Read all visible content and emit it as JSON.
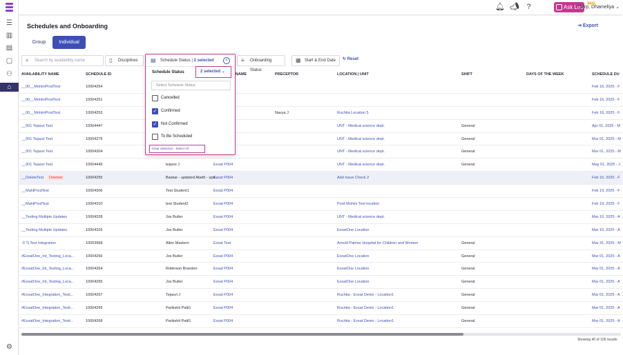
{
  "app": {
    "brand_color": "#8b3fd0",
    "accent": "#3d4fb5",
    "highlight": "#c0398f",
    "ask_leo": "Ask Leo",
    "beta": "BETA",
    "user": "Darp, Dhameliya"
  },
  "page": {
    "title": "Schedules and Onboarding",
    "export": "Export",
    "tabs": [
      "Group",
      "Individual"
    ],
    "active_tab": "Individual"
  },
  "filters": {
    "search_placeholder": "Search by availability name",
    "disciplines": "Disciplines",
    "onboarding_status": "Onboarding Status",
    "start_end_date": "Start & End Date",
    "reset": "Reset"
  },
  "dropdown": {
    "header": "Schedule Status",
    "selected_count": "2 selected",
    "label": "Schedule Status",
    "select_value": "2 selected",
    "search_placeholder": "Select Schedule Status",
    "options": [
      {
        "label": "Cancelled",
        "checked": false
      },
      {
        "label": "Confirmed",
        "checked": true
      },
      {
        "label": "Not Confirmed",
        "checked": true
      },
      {
        "label": "To Be Scheduled",
        "checked": false
      }
    ],
    "footer": "Clear Selection · Select All"
  },
  "table": {
    "headers": [
      "AVAILABILITY NAME",
      "SCHEDULE ID",
      "NAME",
      "PRECEPTOR",
      "LOCATION | UNIT",
      "SHIFT",
      "DAYS OF THE WEEK",
      "SCHEDULE DU"
    ],
    "rows": [
      {
        "name": "__00__MohiniProdTest",
        "id": "10004254",
        "student": "",
        "preceptor": "",
        "preceptor_name": "",
        "location": "",
        "shift": "",
        "date": "Feb 16, 2025 - F",
        "deleted": false
      },
      {
        "name": "__00__MohiniProdTest",
        "id": "10004251",
        "student": "",
        "preceptor": "",
        "preceptor_name": "",
        "location": "",
        "shift": "",
        "date": "Feb 16, 2025 - F",
        "deleted": false
      },
      {
        "name": "__00__MohiniProdTest",
        "id": "10004253",
        "student": "",
        "preceptor": "",
        "preceptor_name": "Navya J",
        "location": "Ruchita Location 5",
        "shift": "",
        "date": "Feb 16, 2025 - F",
        "deleted": false
      },
      {
        "name": "__001 Tejasvi Test",
        "id": "10004447",
        "student": "",
        "preceptor": "",
        "preceptor_name": "",
        "location": "UNT - Medical science dept.",
        "shift": "General",
        "date": "Apr 01, 2025 - M",
        "deleted": false
      },
      {
        "name": "__001 Tejasvi Test",
        "id": "10004275",
        "student": "",
        "preceptor": "",
        "preceptor_name": "",
        "location": "UNT - Medical science dept.",
        "shift": "General",
        "date": "Mar 01, 2025 - M",
        "deleted": false
      },
      {
        "name": "__001 Tejasvi Test",
        "id": "10004304",
        "student": "",
        "preceptor": "",
        "preceptor_name": "",
        "location": "UNT - Medical science dept.",
        "shift": "General",
        "date": "Mar 01, 2025 - M",
        "deleted": false
      },
      {
        "name": "__001 Tejasvi Test",
        "id": "10004449",
        "student": "tejasvi J",
        "preceptor": "Exxat P004",
        "preceptor_name": "",
        "location": "UNT - Medical science dept.",
        "shift": "General",
        "date": "May 01, 2025 - J",
        "deleted": false
      },
      {
        "name": "__DeleteTest",
        "id": "10004255",
        "student": "Baskar - updated Abeth - upd...",
        "preceptor": "Exxat P004",
        "preceptor_name": "",
        "location": "Add Issue Check 2",
        "shift": "",
        "date": "Feb 16, 2025 - F",
        "deleted": true
      },
      {
        "name": "__MahiProdTest",
        "id": "10004306",
        "student": "Test Student1",
        "preceptor": "Exxat P004",
        "preceptor_name": "",
        "location": "",
        "shift": "",
        "date": "Feb 19, 2025 - F",
        "deleted": false
      },
      {
        "name": "__MahiProdTest",
        "id": "10004310",
        "student": "test Student2",
        "preceptor": "Exxat P004",
        "preceptor_name": "",
        "location": "Prod Mohini Test location",
        "shift": "",
        "date": "Feb 19, 2025 - F",
        "deleted": false
      },
      {
        "name": "__Testing Multiple Updates",
        "id": "10004328",
        "student": "Jos Butler",
        "preceptor": "Exxat P004",
        "preceptor_name": "",
        "location": "UNT - Medical science dept.",
        "shift": "",
        "date": "Mar 10, 2025 - A",
        "deleted": false
      },
      {
        "name": "__Testing Multiple Updates",
        "id": "10004326",
        "student": "Jos Butler",
        "preceptor": "Exxat P004",
        "preceptor_name": "",
        "location": "ExxatOne Location",
        "shift": "",
        "date": "Mar 10, 2025 - A",
        "deleted": false
      },
      {
        "name": "-0 Tj Test Integration",
        "id": "10003968",
        "student": "Allen Mastern",
        "preceptor": "Exxat Test",
        "preceptor_name": "",
        "location": "Arnold Palmer Hospital for Children and Women",
        "shift": "General",
        "date": "Mar 31, 2025 - M",
        "deleted": false
      },
      {
        "name": "#ExxatOne_Int_Testing_Loca...",
        "id": "10004266",
        "student": "Jos Butler",
        "preceptor": "Exxat P004",
        "preceptor_name": "",
        "location": "ExxatOne Location",
        "shift": "General",
        "date": "Mar 01, 2025 - A",
        "deleted": false
      },
      {
        "name": "#ExxatOne_Int_Testing_Loca...",
        "id": "10004264",
        "student": "Robinson Branden",
        "preceptor": "Exxat P004",
        "preceptor_name": "",
        "location": "ExxatOne Location",
        "shift": "General",
        "date": "Mar 01, 2025 - A",
        "deleted": false
      },
      {
        "name": "#ExxatOne_Int_Testing_Loca...",
        "id": "10004265",
        "student": "Jos Butler",
        "preceptor": "Exxat P004",
        "preceptor_name": "",
        "location": "ExxatOne Location",
        "shift": "General",
        "date": "Mar 01, 2025 - A",
        "deleted": false
      },
      {
        "name": "#ExxatOne_Integration_Testi...",
        "id": "10004267",
        "student": "Tejasvi J",
        "preceptor": "Exxat P004",
        "preceptor_name": "",
        "location": "Ruchita - Exxat Demo - Location1",
        "shift": "General",
        "date": "Mar 01, 2025 - A",
        "deleted": false
      },
      {
        "name": "#ExxatOne_Integration_Testi...",
        "id": "10004269",
        "student": "Parikshit Patil1",
        "preceptor": "Exxat P004",
        "preceptor_name": "",
        "location": "Ruchita - Exxat Demo - Location1",
        "shift": "General",
        "date": "Mar 01, 2025 - A",
        "deleted": false
      },
      {
        "name": "#ExxatOne_Integration_Testi...",
        "id": "10004268",
        "student": "Parikshit Patil1",
        "preceptor": "Exxat P004",
        "preceptor_name": "",
        "location": "Ruchita - Exxat Demo - Location1",
        "shift": "General",
        "date": "Mar 01, 2025 - A",
        "deleted": false
      }
    ],
    "deleted_label": "Deleted",
    "showing": "Showing 40 of 105 results"
  }
}
